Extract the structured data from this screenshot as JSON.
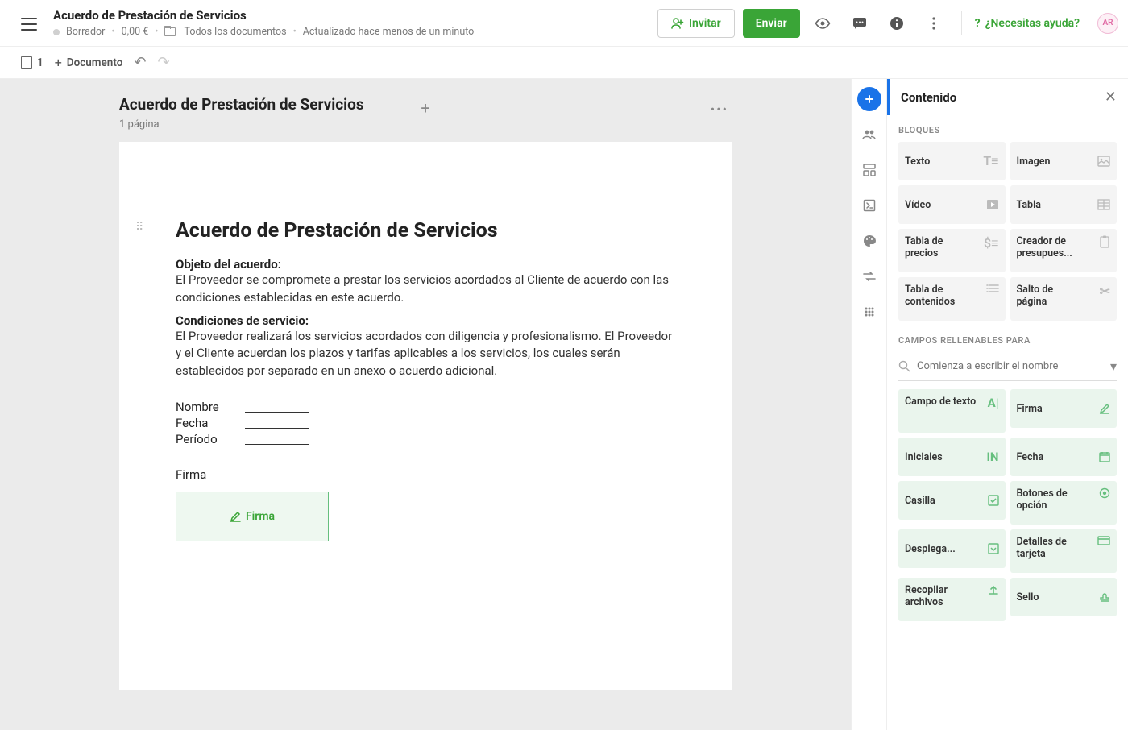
{
  "header": {
    "title": "Acuerdo de Prestación de Servicios",
    "status": "Borrador",
    "price": "0,00 €",
    "folder": "Todos los documentos",
    "updated": "Actualizado hace menos de un minuto",
    "invite": "Invitar",
    "send": "Enviar",
    "help": "¿Necesitas ayuda?",
    "avatar": "AR"
  },
  "editbar": {
    "count": "1",
    "doc": "Documento"
  },
  "dochead": {
    "title": "Acuerdo de Prestación de Servicios",
    "sub": "1 página"
  },
  "page": {
    "h1": "Acuerdo de Prestación de Servicios",
    "s1": "Objeto del acuerdo:",
    "t1": "El Proveedor se compromete a prestar los servicios acordados al Cliente de acuerdo con las condiciones establecidas en este acuerdo.",
    "s2": "Condiciones de servicio:",
    "t2": "El Proveedor realizará los servicios acordados con diligencia y profesionalismo. El Proveedor y el Cliente acuerdan los plazos y tarifas aplicables a los servicios, los cuales serán establecidos por separado en un anexo o acuerdo adicional.",
    "f_name": "Nombre",
    "f_date": "Fecha",
    "f_period": "Período",
    "sig_label": "Firma",
    "sig_btn": "Firma"
  },
  "panel": {
    "title": "Contenido",
    "sec_blocks": "BLOQUES",
    "sec_fill": "CAMPOS RELLENABLES PARA",
    "search_ph": "Comienza a escribir el nombre",
    "blocks": {
      "text": "Texto",
      "image": "Imagen",
      "video": "Vídeo",
      "table": "Tabla",
      "pricing": "Tabla de precios",
      "quote": "Creador de presupues...",
      "toc": "Tabla de contenidos",
      "pgbreak": "Salto de página"
    },
    "fields": {
      "text": "Campo de texto",
      "sign": "Firma",
      "initials": "Iniciales",
      "date": "Fecha",
      "checkbox": "Casilla",
      "radio": "Botones de opción",
      "dropdown": "Desplega...",
      "card": "Detalles de tarjeta",
      "collect": "Recopilar archivos",
      "stamp": "Sello"
    }
  }
}
